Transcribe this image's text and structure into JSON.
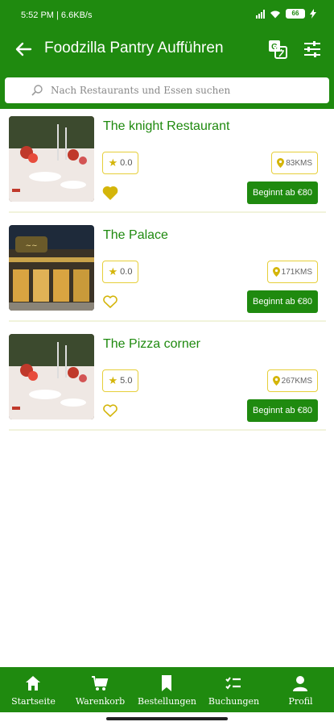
{
  "status_bar": {
    "time": "5:52 PM | 6.6KB/s",
    "battery": "66"
  },
  "header": {
    "title": "Foodzilla Pantry Aufführen"
  },
  "search": {
    "placeholder": "Nach Restaurants und Essen suchen"
  },
  "restaurants": [
    {
      "name": "The knight Restaurant",
      "rating": "0.0",
      "distance": "83KMS",
      "price_label": "Beginnt ab €80",
      "favorite": true
    },
    {
      "name": "The Palace",
      "rating": "0.0",
      "distance": "171KMS",
      "price_label": "Beginnt ab €80",
      "favorite": false
    },
    {
      "name": "The Pizza corner",
      "rating": "5.0",
      "distance": "267KMS",
      "price_label": "Beginnt ab €80",
      "favorite": false
    }
  ],
  "bottom_nav": {
    "items": [
      {
        "label": "Startseite",
        "icon": "home-icon"
      },
      {
        "label": "Warenkorb",
        "icon": "cart-icon"
      },
      {
        "label": "Bestellungen",
        "icon": "bookmark-icon"
      },
      {
        "label": "Buchungen",
        "icon": "checklist-icon"
      },
      {
        "label": "Profil",
        "icon": "person-icon"
      }
    ]
  },
  "colors": {
    "primary": "#1f8a0f",
    "accent_yellow": "#d4b50a",
    "background": "#ffffff"
  }
}
